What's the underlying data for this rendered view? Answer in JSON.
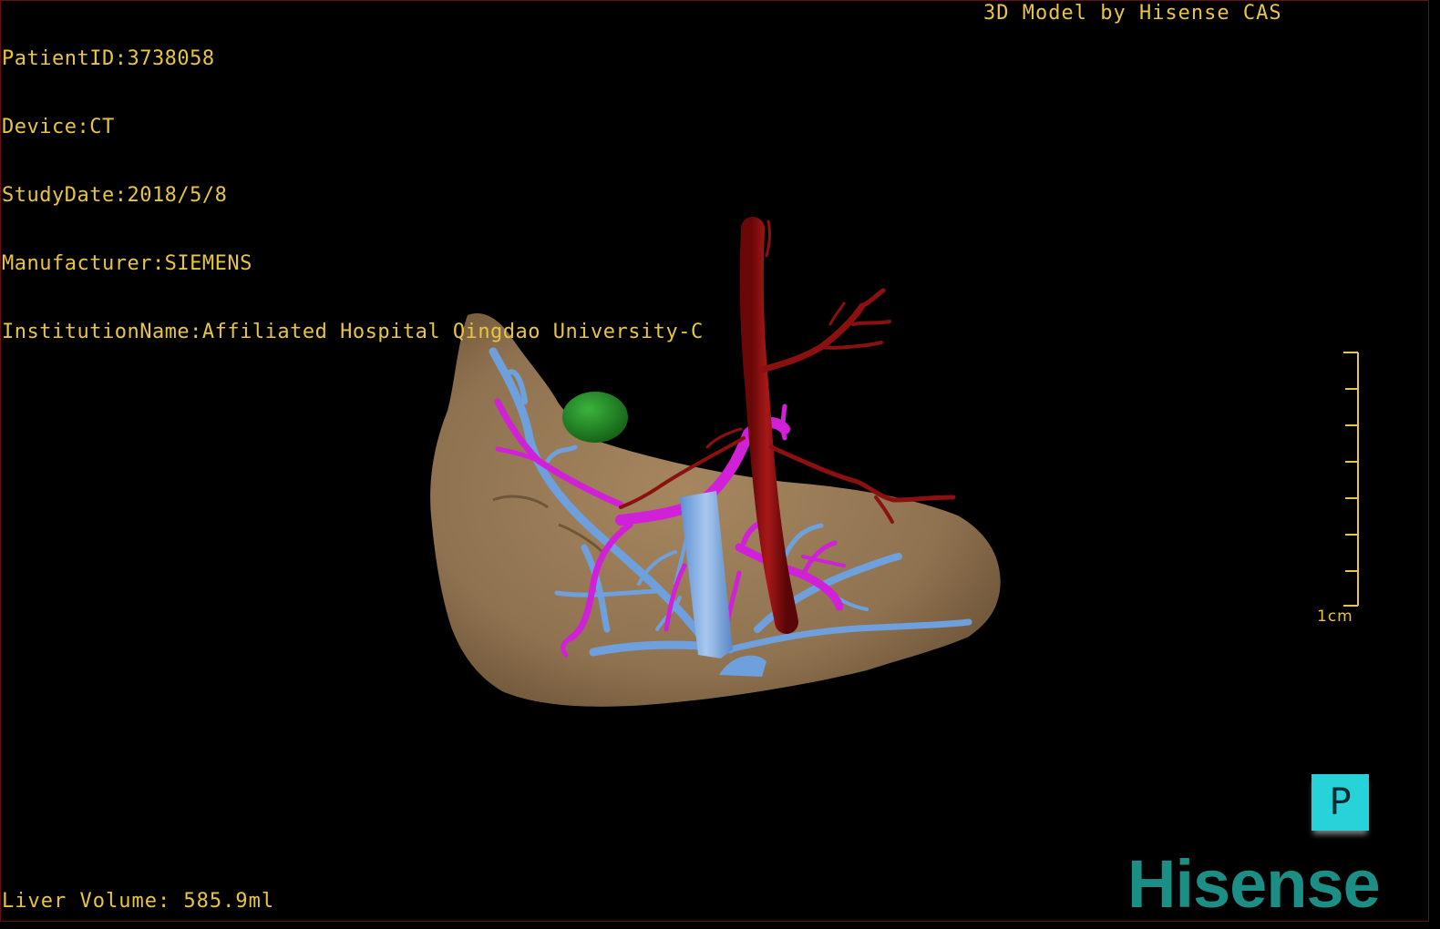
{
  "overlay": {
    "patient_id": "PatientID:3738058",
    "device": "Device:CT",
    "study_date": "StudyDate:2018/5/8",
    "manufacturer": "Manufacturer:SIEMENS",
    "institution": "InstitutionName:Affiliated Hospital Qingdao University-C",
    "model_by": "3D Model by Hisense CAS",
    "liver_volume": "Liver Volume: 585.9ml"
  },
  "scale_bar": {
    "label": "1cm",
    "color": "#e8c542"
  },
  "orientation_cube": {
    "label": "P",
    "color": "#27d2d8"
  },
  "brand": {
    "logo_text": "Hisense",
    "color": "#1b8e86"
  },
  "structures": {
    "liver_color": "#8f7250",
    "artery_color": "#8b1010",
    "portal_vein_color": "#d020d8",
    "hepatic_vein_color": "#6fa0de",
    "lesion_color": "#1e8c22"
  }
}
